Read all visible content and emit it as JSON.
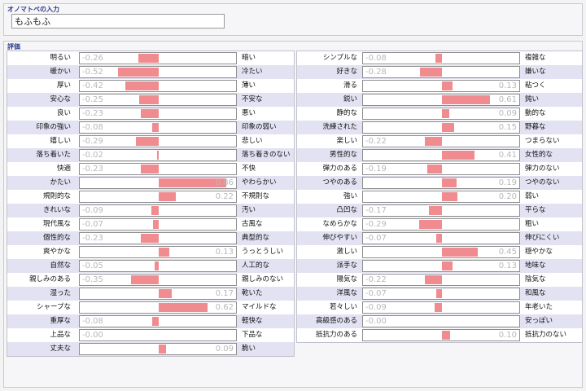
{
  "onomatopoeia": {
    "label": "オノマトペの入力",
    "value": "もふもふ"
  },
  "evaluation": {
    "label": "評価",
    "colors": {
      "bar": "#f08b8f",
      "shade": "#e2e2f3"
    },
    "columns": [
      [
        {
          "left": "明るい",
          "right": "暗い",
          "value": -0.26
        },
        {
          "left": "暖かい",
          "right": "冷たい",
          "value": -0.52
        },
        {
          "left": "厚い",
          "right": "薄い",
          "value": -0.42
        },
        {
          "left": "安心な",
          "right": "不安な",
          "value": -0.25
        },
        {
          "left": "良い",
          "right": "悪い",
          "value": -0.23
        },
        {
          "left": "印象の強い",
          "right": "印象の弱い",
          "value": -0.08
        },
        {
          "left": "嬉しい",
          "right": "悲しい",
          "value": -0.29
        },
        {
          "left": "落ち着いた",
          "right": "落ち着きのない",
          "value": -0.02
        },
        {
          "left": "快適",
          "right": "不快",
          "value": -0.23
        },
        {
          "left": "かたい",
          "right": "やわらかい",
          "value": 0.86
        },
        {
          "left": "規則的な",
          "right": "不規則な",
          "value": 0.22
        },
        {
          "left": "きれいな",
          "right": "汚い",
          "value": -0.09
        },
        {
          "left": "現代風な",
          "right": "古風な",
          "value": -0.07
        },
        {
          "left": "個性的な",
          "right": "典型的な",
          "value": -0.23
        },
        {
          "left": "爽やかな",
          "right": "うっとうしい",
          "value": 0.13
        },
        {
          "left": "自然な",
          "right": "人工的な",
          "value": -0.05
        },
        {
          "left": "親しみのある",
          "right": "親しみのない",
          "value": -0.35
        },
        {
          "left": "湿った",
          "right": "乾いた",
          "value": 0.17
        },
        {
          "left": "シャープな",
          "right": "マイルドな",
          "value": 0.62
        },
        {
          "left": "重厚な",
          "right": "軽快な",
          "value": -0.08
        },
        {
          "left": "上品な",
          "right": "下品な",
          "value": -0.0
        },
        {
          "left": "丈夫な",
          "right": "脆い",
          "value": 0.09
        }
      ],
      [
        {
          "left": "シンプルな",
          "right": "複雑な",
          "value": -0.08
        },
        {
          "left": "好きな",
          "right": "嫌いな",
          "value": -0.28
        },
        {
          "left": "滑る",
          "right": "粘つく",
          "value": 0.13
        },
        {
          "left": "鋭い",
          "right": "鈍い",
          "value": 0.61
        },
        {
          "left": "静的な",
          "right": "動的な",
          "value": 0.09
        },
        {
          "left": "洗練された",
          "right": "野暮な",
          "value": 0.15
        },
        {
          "left": "楽しい",
          "right": "つまらない",
          "value": -0.22
        },
        {
          "left": "男性的な",
          "right": "女性的な",
          "value": 0.41
        },
        {
          "left": "弾力のある",
          "right": "弾力のない",
          "value": -0.19
        },
        {
          "left": "つやのある",
          "right": "つやのない",
          "value": 0.19
        },
        {
          "left": "強い",
          "right": "弱い",
          "value": 0.2
        },
        {
          "left": "凸凹な",
          "right": "平らな",
          "value": -0.17
        },
        {
          "left": "なめらかな",
          "right": "粗い",
          "value": -0.29
        },
        {
          "left": "伸びやすい",
          "right": "伸びにくい",
          "value": -0.07
        },
        {
          "left": "激しい",
          "right": "穏やかな",
          "value": 0.45
        },
        {
          "left": "派手な",
          "right": "地味な",
          "value": 0.13
        },
        {
          "left": "陽気な",
          "right": "陰気な",
          "value": -0.22
        },
        {
          "left": "洋風な",
          "right": "和風な",
          "value": -0.07
        },
        {
          "left": "若々しい",
          "right": "年老いた",
          "value": -0.09
        },
        {
          "left": "高級感のある",
          "right": "安っぽい",
          "value": -0.0
        },
        {
          "left": "抵抗力のある",
          "right": "抵抗力のない",
          "value": 0.1
        }
      ]
    ]
  }
}
